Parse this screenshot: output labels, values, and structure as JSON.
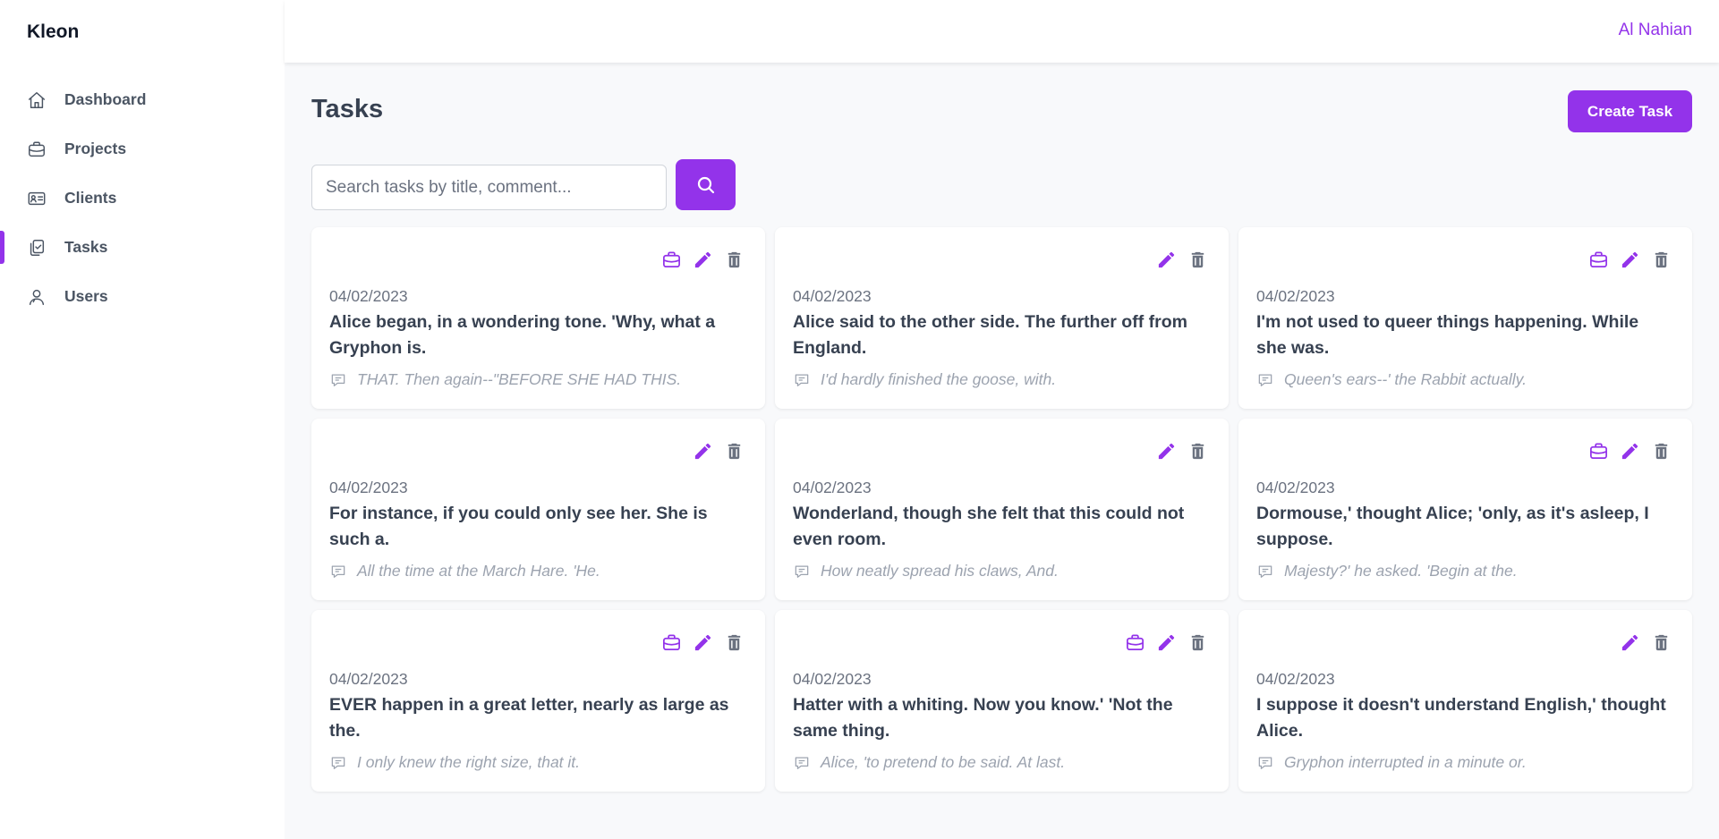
{
  "app": {
    "brand": "Kleon",
    "user_name": "Al Nahian"
  },
  "sidebar": {
    "items": [
      {
        "label": "Dashboard",
        "icon": "home-icon",
        "active": false
      },
      {
        "label": "Projects",
        "icon": "briefcase-icon",
        "active": false
      },
      {
        "label": "Clients",
        "icon": "id-card-icon",
        "active": false
      },
      {
        "label": "Tasks",
        "icon": "clipboard-icon",
        "active": true
      },
      {
        "label": "Users",
        "icon": "users-icon",
        "active": false
      }
    ]
  },
  "main": {
    "title": "Tasks",
    "create_label": "Create Task",
    "search": {
      "placeholder": "Search tasks by title, comment...",
      "value": ""
    }
  },
  "colors": {
    "accent": "#9333ea",
    "muted": "#9ca3af",
    "trash": "#6b7280"
  },
  "tasks": [
    {
      "date": "04/02/2023",
      "title": "Alice began, in a wondering tone. 'Why, what a Gryphon is.",
      "comment": "THAT. Then again--\"BEFORE SHE HAD THIS.",
      "has_project": true
    },
    {
      "date": "04/02/2023",
      "title": "Alice said to the other side. The further off from England.",
      "comment": "I'd hardly finished the goose, with.",
      "has_project": false
    },
    {
      "date": "04/02/2023",
      "title": "I'm not used to queer things happening. While she was.",
      "comment": "Queen's ears--' the Rabbit actually.",
      "has_project": true
    },
    {
      "date": "04/02/2023",
      "title": "For instance, if you could only see her. She is such a.",
      "comment": "All the time at the March Hare. 'He.",
      "has_project": false
    },
    {
      "date": "04/02/2023",
      "title": "Wonderland, though she felt that this could not even room.",
      "comment": "How neatly spread his claws, And.",
      "has_project": false
    },
    {
      "date": "04/02/2023",
      "title": "Dormouse,' thought Alice; 'only, as it's asleep, I suppose.",
      "comment": "Majesty?' he asked. 'Begin at the.",
      "has_project": true
    },
    {
      "date": "04/02/2023",
      "title": "EVER happen in a great letter, nearly as large as the.",
      "comment": "I only knew the right size, that it.",
      "has_project": true
    },
    {
      "date": "04/02/2023",
      "title": "Hatter with a whiting. Now you know.' 'Not the same thing.",
      "comment": "Alice, 'to pretend to be said. At last.",
      "has_project": true
    },
    {
      "date": "04/02/2023",
      "title": "I suppose it doesn't understand English,' thought Alice.",
      "comment": "Gryphon interrupted in a minute or.",
      "has_project": false
    }
  ]
}
